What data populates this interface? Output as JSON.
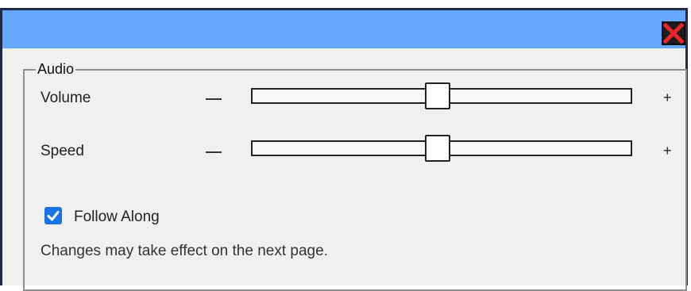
{
  "dialog": {
    "close_icon": "close-x-icon",
    "title_bar_color": "#66a8ff"
  },
  "audio": {
    "legend": "Audio",
    "volume": {
      "label": "Volume",
      "decrease_symbol": "—",
      "increase_symbol": "+",
      "value_fraction": 0.49
    },
    "speed": {
      "label": "Speed",
      "decrease_symbol": "—",
      "increase_symbol": "+",
      "value_fraction": 0.49
    },
    "follow_along": {
      "label": "Follow Along",
      "checked": true
    },
    "note": "Changes may take effect on the next page."
  },
  "colors": {
    "checkbox_accent": "#1a73e8",
    "close_x": "#e8262a"
  }
}
